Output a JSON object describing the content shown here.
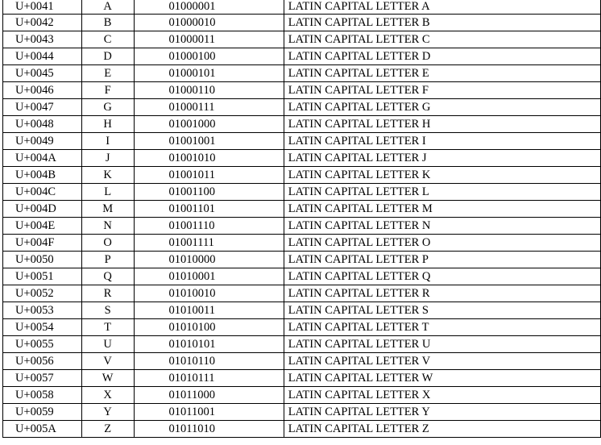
{
  "table": {
    "rows": [
      {
        "code": "U+0041",
        "char": "A",
        "binary": "01000001",
        "name": "LATIN CAPITAL LETTER A"
      },
      {
        "code": "U+0042",
        "char": "B",
        "binary": "01000010",
        "name": "LATIN CAPITAL LETTER B"
      },
      {
        "code": "U+0043",
        "char": "C",
        "binary": "01000011",
        "name": "LATIN CAPITAL LETTER C"
      },
      {
        "code": "U+0044",
        "char": "D",
        "binary": "01000100",
        "name": "LATIN CAPITAL LETTER D"
      },
      {
        "code": "U+0045",
        "char": "E",
        "binary": "01000101",
        "name": "LATIN CAPITAL LETTER E"
      },
      {
        "code": "U+0046",
        "char": "F",
        "binary": "01000110",
        "name": "LATIN CAPITAL LETTER F"
      },
      {
        "code": "U+0047",
        "char": "G",
        "binary": "01000111",
        "name": "LATIN CAPITAL LETTER G"
      },
      {
        "code": "U+0048",
        "char": "H",
        "binary": "01001000",
        "name": "LATIN CAPITAL LETTER H"
      },
      {
        "code": "U+0049",
        "char": "I",
        "binary": "01001001",
        "name": "LATIN CAPITAL LETTER I"
      },
      {
        "code": "U+004A",
        "char": "J",
        "binary": "01001010",
        "name": "LATIN CAPITAL LETTER J"
      },
      {
        "code": "U+004B",
        "char": "K",
        "binary": "01001011",
        "name": "LATIN CAPITAL LETTER K"
      },
      {
        "code": "U+004C",
        "char": "L",
        "binary": "01001100",
        "name": "LATIN CAPITAL LETTER L"
      },
      {
        "code": "U+004D",
        "char": "M",
        "binary": "01001101",
        "name": "LATIN CAPITAL LETTER M"
      },
      {
        "code": "U+004E",
        "char": "N",
        "binary": "01001110",
        "name": "LATIN CAPITAL LETTER N"
      },
      {
        "code": "U+004F",
        "char": "O",
        "binary": "01001111",
        "name": "LATIN CAPITAL LETTER O"
      },
      {
        "code": "U+0050",
        "char": "P",
        "binary": "01010000",
        "name": "LATIN CAPITAL LETTER P"
      },
      {
        "code": "U+0051",
        "char": "Q",
        "binary": "01010001",
        "name": "LATIN CAPITAL LETTER Q"
      },
      {
        "code": "U+0052",
        "char": "R",
        "binary": "01010010",
        "name": "LATIN CAPITAL LETTER R"
      },
      {
        "code": "U+0053",
        "char": "S",
        "binary": "01010011",
        "name": "LATIN CAPITAL LETTER S"
      },
      {
        "code": "U+0054",
        "char": "T",
        "binary": "01010100",
        "name": "LATIN CAPITAL LETTER T"
      },
      {
        "code": "U+0055",
        "char": "U",
        "binary": "01010101",
        "name": "LATIN CAPITAL LETTER U"
      },
      {
        "code": "U+0056",
        "char": "V",
        "binary": "01010110",
        "name": "LATIN CAPITAL LETTER V"
      },
      {
        "code": "U+0057",
        "char": "W",
        "binary": "01010111",
        "name": "LATIN CAPITAL LETTER W"
      },
      {
        "code": "U+0058",
        "char": "X",
        "binary": "01011000",
        "name": "LATIN CAPITAL LETTER X"
      },
      {
        "code": "U+0059",
        "char": "Y",
        "binary": "01011001",
        "name": "LATIN CAPITAL LETTER Y"
      },
      {
        "code": "U+005A",
        "char": "Z",
        "binary": "01011010",
        "name": "LATIN CAPITAL LETTER Z"
      }
    ]
  }
}
